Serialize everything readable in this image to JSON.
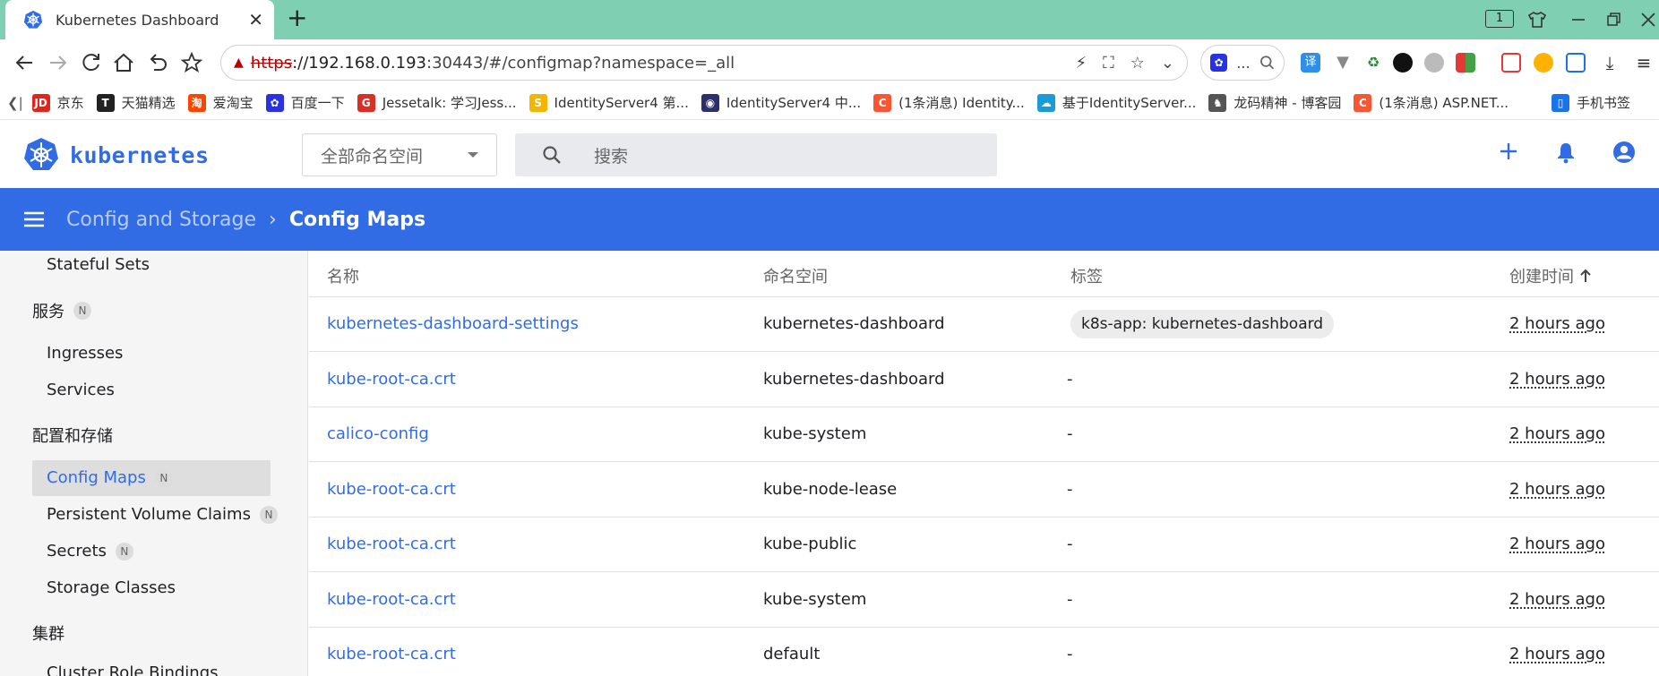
{
  "browser": {
    "tab_title": "Kubernetes Dashboard",
    "tab_close": "✕",
    "new_tab": "+",
    "window_badge": "1",
    "url_protocol": "https",
    "url_host": "://192.168.0.193",
    "url_rest": ":30443/#/configmap?namespace=_all",
    "search_ellipsis": "...",
    "bookmarks": [
      {
        "label": "京东",
        "icon": "jd-icon",
        "color": "#e1251b",
        "glyph": "JD"
      },
      {
        "label": "天猫精选",
        "icon": "tmall-icon",
        "color": "#222222",
        "glyph": "T"
      },
      {
        "label": "爱淘宝",
        "icon": "taobao-icon",
        "color": "#ff4400",
        "glyph": "淘"
      },
      {
        "label": "百度一下",
        "icon": "baidu-icon",
        "color": "#2932e1",
        "glyph": "✿"
      },
      {
        "label": "Jessetalk: 学习Jess...",
        "icon": "jessetalk-icon",
        "color": "#d93025",
        "glyph": "G"
      },
      {
        "label": "IdentityServer4 第...",
        "icon": "identityserver-icon",
        "color": "#f5b400",
        "glyph": "S"
      },
      {
        "label": "IdentityServer4 中...",
        "icon": "identityserver-cn-icon",
        "color": "#2d2f6b",
        "glyph": "◉"
      },
      {
        "label": "(1条消息) Identity...",
        "icon": "csdn-icon",
        "color": "#fc5531",
        "glyph": "C"
      },
      {
        "label": "基于IdentityServer...",
        "icon": "cloud-icon",
        "color": "#1a9ad6",
        "glyph": "☁"
      },
      {
        "label": "龙码精神 - 博客园",
        "icon": "cnblogs-icon",
        "color": "#555555",
        "glyph": "♞"
      },
      {
        "label": "(1条消息) ASP.NET...",
        "icon": "csdn-icon",
        "color": "#fc5531",
        "glyph": "C"
      },
      {
        "label": "手机书签",
        "icon": "phone-bookmark-icon",
        "color": "#1a73e8",
        "glyph": "▯"
      }
    ]
  },
  "app": {
    "brand": "kubernetes",
    "namespace_select": "全部命名空间",
    "search_placeholder": "搜索",
    "accent": "#326ce5",
    "breadcrumb": {
      "parent": "Config and Storage",
      "separator": "›",
      "current": "Config Maps"
    }
  },
  "sidebar": {
    "stateful_sets": "Stateful Sets",
    "services_header": "服务",
    "ingresses": "Ingresses",
    "services": "Services",
    "config_header": "配置和存储",
    "config_maps": "Config Maps",
    "pvc": "Persistent Volume Claims",
    "secrets": "Secrets",
    "storage_classes": "Storage Classes",
    "cluster_header": "集群",
    "cluster_role_bindings": "Cluster Role Bindings",
    "badge": "N"
  },
  "table": {
    "columns": {
      "name": "名称",
      "namespace": "命名空间",
      "labels": "标签",
      "created": "创建时间"
    },
    "rows": [
      {
        "name": "kubernetes-dashboard-settings",
        "namespace": "kubernetes-dashboard",
        "label": "k8s-app: kubernetes-dashboard",
        "created": "2 hours ago"
      },
      {
        "name": "kube-root-ca.crt",
        "namespace": "kubernetes-dashboard",
        "label": "-",
        "created": "2 hours ago"
      },
      {
        "name": "calico-config",
        "namespace": "kube-system",
        "label": "-",
        "created": "2 hours ago"
      },
      {
        "name": "kube-root-ca.crt",
        "namespace": "kube-node-lease",
        "label": "-",
        "created": "2 hours ago"
      },
      {
        "name": "kube-root-ca.crt",
        "namespace": "kube-public",
        "label": "-",
        "created": "2 hours ago"
      },
      {
        "name": "kube-root-ca.crt",
        "namespace": "kube-system",
        "label": "-",
        "created": "2 hours ago"
      },
      {
        "name": "kube-root-ca.crt",
        "namespace": "default",
        "label": "-",
        "created": "2 hours ago"
      }
    ]
  }
}
